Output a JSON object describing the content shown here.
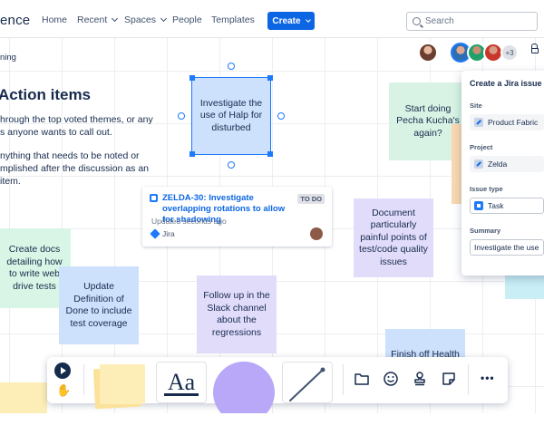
{
  "nav": {
    "logo_fragment": "ence",
    "items": [
      {
        "label": "Home",
        "has_dropdown": false
      },
      {
        "label": "Recent",
        "has_dropdown": true
      },
      {
        "label": "Spaces",
        "has_dropdown": true
      },
      {
        "label": "People",
        "has_dropdown": false
      },
      {
        "label": "Templates",
        "has_dropdown": false
      }
    ],
    "create_label": "Create",
    "search_placeholder": "Search"
  },
  "page": {
    "breadcrumb_fragment": "ning",
    "heading": "Action items",
    "paragraphs": [
      "hrough the top voted themes, or any s anyone wants to call out.",
      "nything that needs to be noted or mplished after the discussion as an item."
    ]
  },
  "collaborators": {
    "more_count": "+3"
  },
  "stickies": {
    "halp": "Investigate the use of Halp for disturbed",
    "pecha": "Start doing Pecha Kucha's again?",
    "document": "Document particularly painful points of test/code quality issues",
    "docs": "Create docs detailing how to write web drive tests",
    "definition": "Update Definition of Done to include test coverage",
    "slack": "Follow up in the Slack channel about the regressions",
    "health": "Finish off Health"
  },
  "jira_card": {
    "title": "ZELDA-30: Investigate overlapping rotations to allow for shadowing",
    "status": "TO DO",
    "updated": "Updated seconds ago",
    "source": "Jira"
  },
  "jira_panel": {
    "title": "Create a Jira issue",
    "site_label": "Site",
    "site_value": "Product Fabric",
    "project_label": "Project",
    "project_value": "Zelda",
    "issue_type_label": "Issue type",
    "issue_type_value": "Task",
    "summary_label": "Summary",
    "summary_value": "Investigate the use"
  },
  "toolbar": {
    "text_tool_label": "Aa",
    "more_label": "•••"
  },
  "colors": {
    "accent": "#0c66e4",
    "selection": "#1d7afc"
  }
}
